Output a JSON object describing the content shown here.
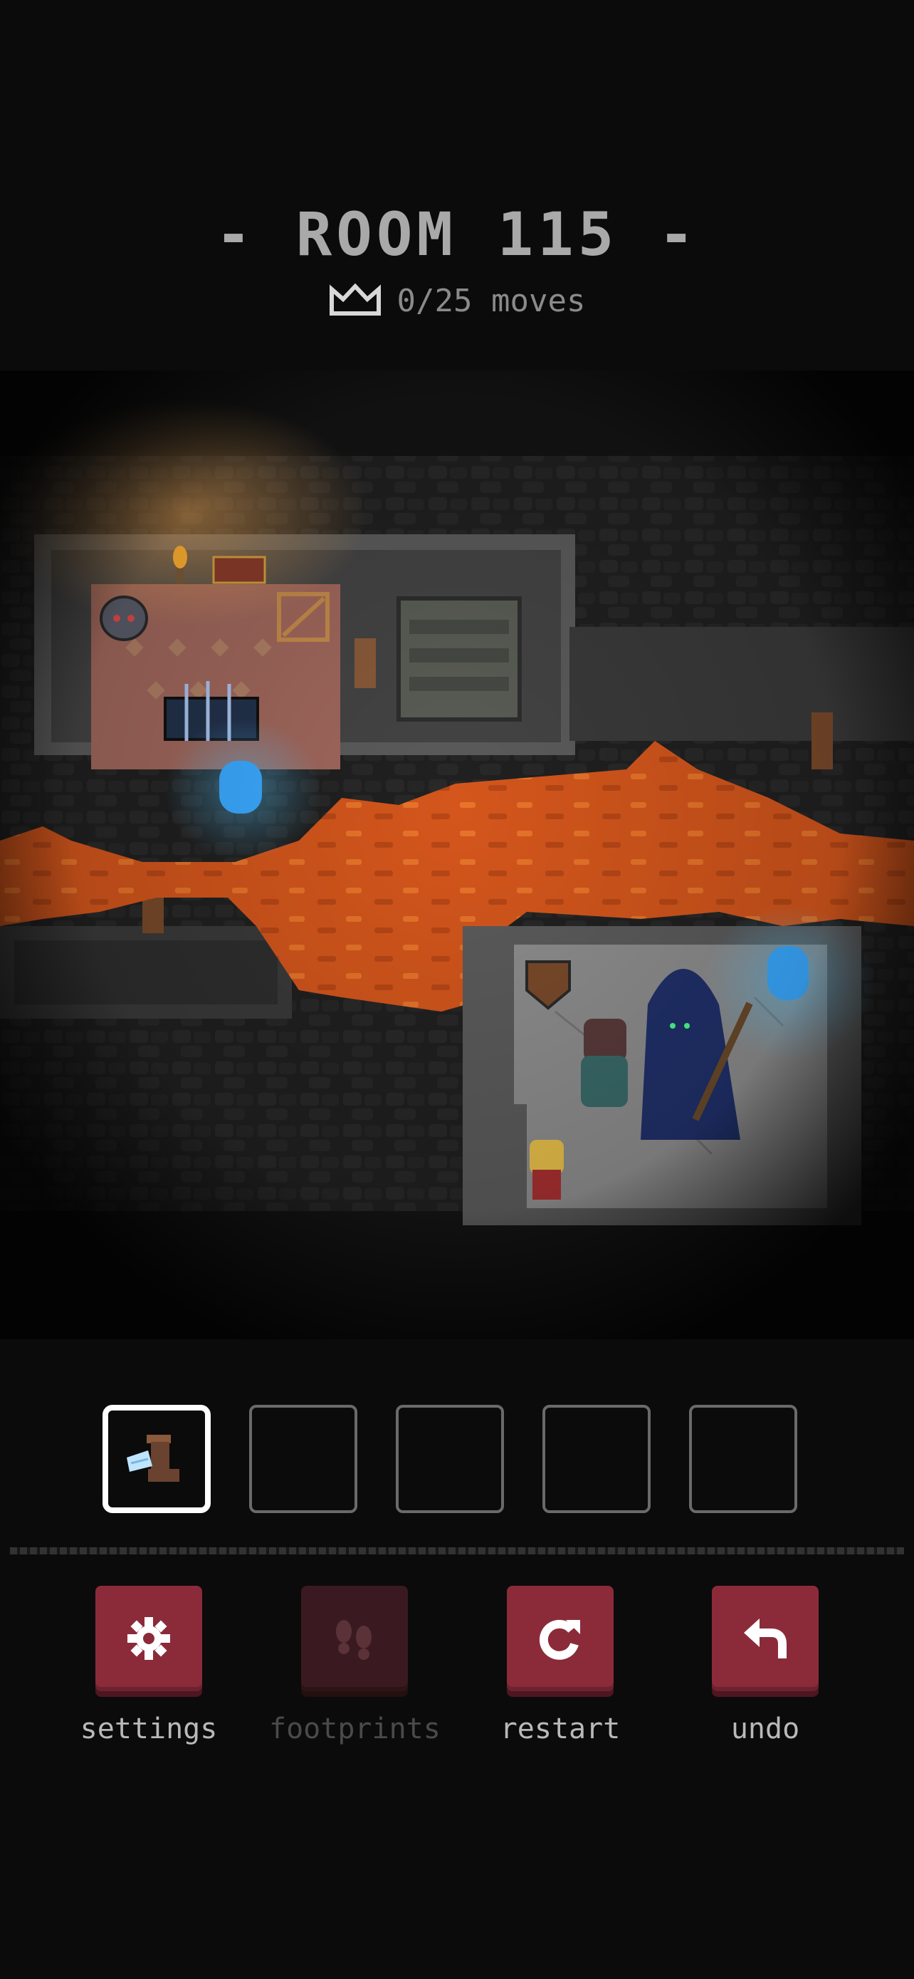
{
  "header": {
    "title": "- ROOM 115 -",
    "moves_text": "0/25 moves",
    "crown_icon": "crown-icon"
  },
  "inventory": {
    "slots": [
      {
        "icon": "winged-boot-icon",
        "selected": true
      },
      {
        "icon": null,
        "selected": false
      },
      {
        "icon": null,
        "selected": false
      },
      {
        "icon": null,
        "selected": false
      },
      {
        "icon": null,
        "selected": false
      }
    ]
  },
  "controls": {
    "settings": {
      "label": "settings",
      "icon": "gear-icon",
      "enabled": true
    },
    "footprints": {
      "label": "footprints",
      "icon": "footprints-icon",
      "enabled": false
    },
    "restart": {
      "label": "restart",
      "icon": "restart-icon",
      "enabled": true
    },
    "undo": {
      "label": "undo",
      "icon": "undo-icon",
      "enabled": true
    }
  },
  "colors": {
    "button": "#8b2b3a",
    "button_disabled": "#3a1a20",
    "lava": "#d4561c",
    "portal": "#3aa9ff",
    "floor": "#4a4a4a"
  }
}
